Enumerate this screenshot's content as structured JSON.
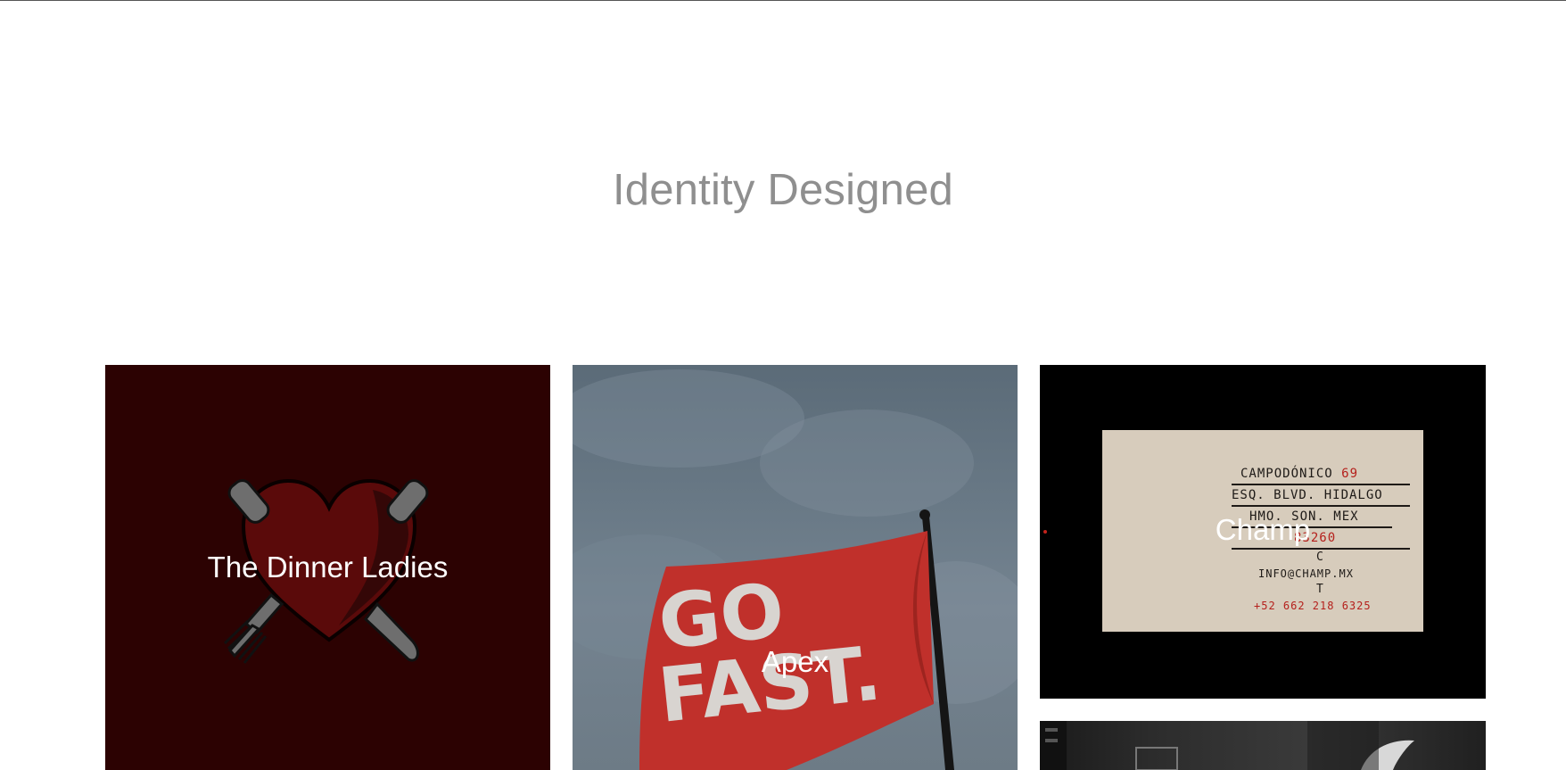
{
  "page": {
    "title": "Identity Designed"
  },
  "projects": [
    {
      "name": "The Dinner Ladies"
    },
    {
      "name": "Apex",
      "image_text": "GO FAST."
    },
    {
      "name": "Champ",
      "card": {
        "line1": "CAMPODÓNICO",
        "line1_num": "69",
        "line2": "ESQ. BLVD. HIDALGO",
        "line3": "HMO. SON. MEX",
        "line4": "83260",
        "letter_c": "C",
        "email": "INFO@CHAMP.MX",
        "letter_t": "T",
        "phone": "+52 662 218 6325"
      }
    },
    {
      "name": ""
    }
  ],
  "colors": {
    "title": "#8f8f8f",
    "dinner_bg": "#2c0202",
    "flag_red": "#c0302b",
    "card_red": "#b5201c"
  }
}
